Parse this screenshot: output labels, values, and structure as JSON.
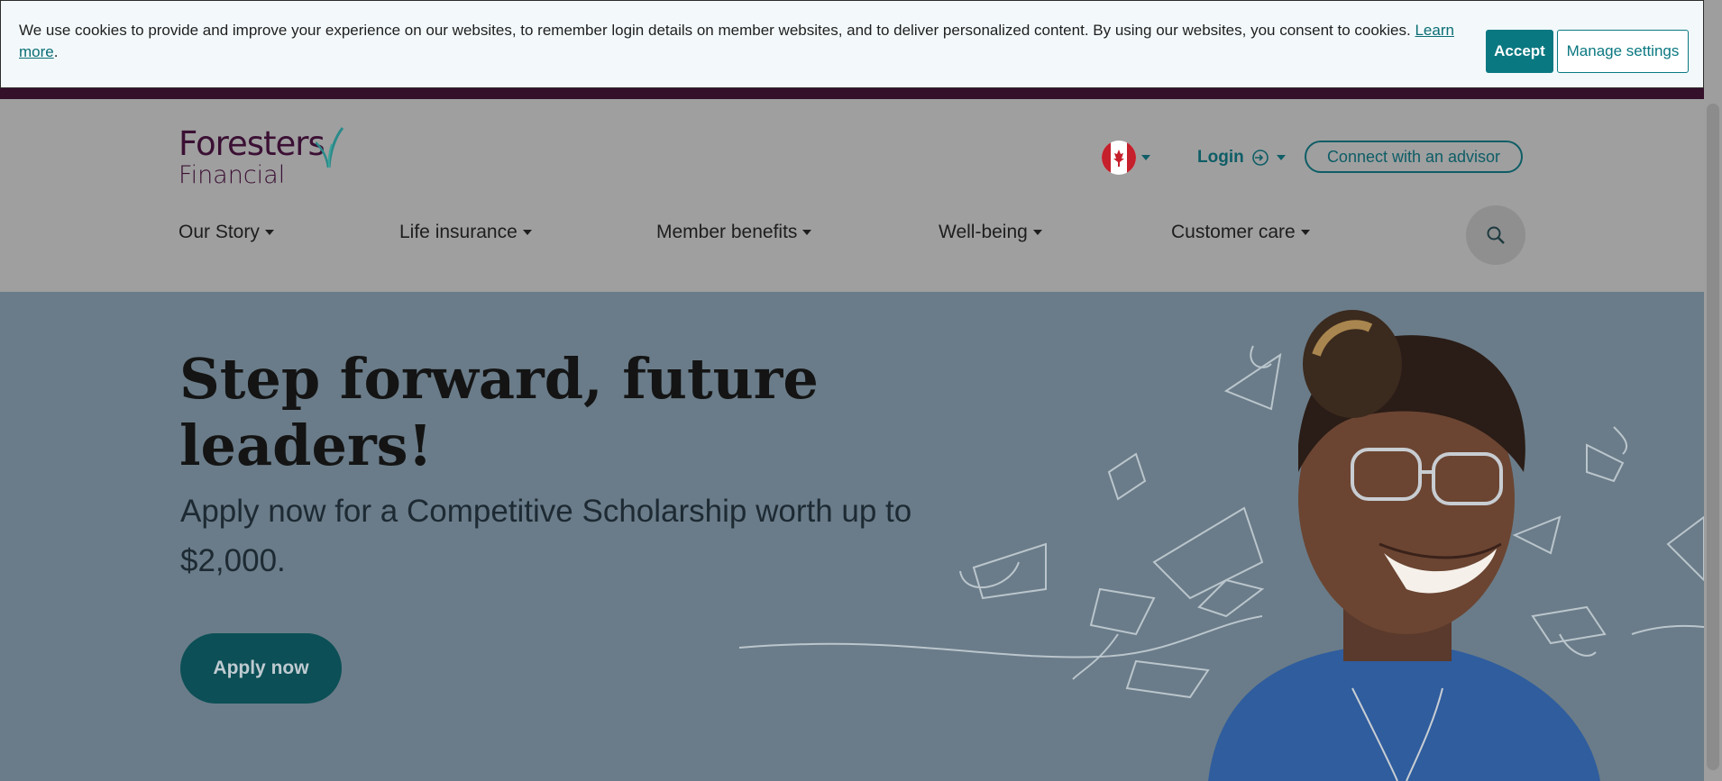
{
  "cookie_banner": {
    "message": "We use cookies to provide and improve your experience on our websites, to remember login details on member websites, and to deliver personalized content. By using our websites, you consent to cookies.",
    "learn_more": "Learn more",
    "period": ".",
    "accept_label": "Accept",
    "manage_label": "Manage settings"
  },
  "header": {
    "logo_line1": "Foresters",
    "logo_line2": "Financial",
    "country_flag": "canada-flag-icon",
    "login_label": "Login",
    "advisor_label": "Connect with an advisor"
  },
  "nav": {
    "items": [
      {
        "label": "Our Story"
      },
      {
        "label": "Life insurance"
      },
      {
        "label": "Member benefits"
      },
      {
        "label": "Well-being"
      },
      {
        "label": "Customer care"
      }
    ],
    "search_icon": "search-icon"
  },
  "hero": {
    "title": "Step forward, future leaders!",
    "subtitle": "Apply now for a Competitive Scholarship worth up to $2,000.",
    "cta_label": "Apply now"
  },
  "colors": {
    "brand_purple": "#3b1034",
    "brand_teal": "#0a7881",
    "hero_bg": "#6a7c89"
  }
}
